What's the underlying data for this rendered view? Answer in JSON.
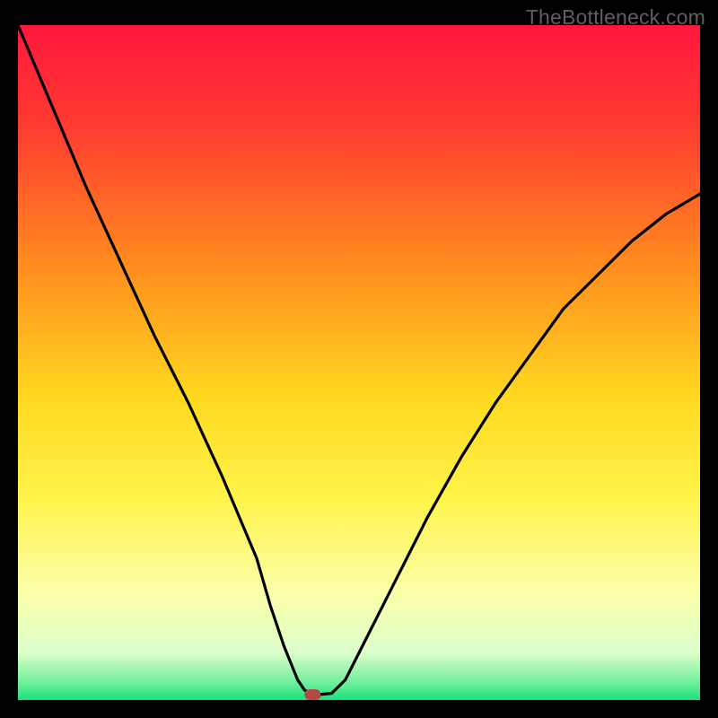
{
  "watermark": "TheBottleneck.com",
  "chart_data": {
    "type": "line",
    "title": "",
    "xlabel": "",
    "ylabel": "",
    "xlim": [
      0,
      100
    ],
    "ylim": [
      0,
      100
    ],
    "x": [
      0,
      5,
      10,
      15,
      20,
      25,
      30,
      35,
      37,
      39,
      41,
      42,
      43,
      44,
      46,
      48,
      50,
      55,
      60,
      65,
      70,
      75,
      80,
      85,
      90,
      95,
      100
    ],
    "values": [
      100,
      88,
      76,
      65,
      54,
      44,
      33,
      21,
      14,
      8,
      3,
      1.5,
      0.8,
      0.8,
      1,
      3,
      7,
      17,
      27,
      36,
      44,
      51,
      58,
      63,
      68,
      72,
      75
    ],
    "marker": {
      "x": 43.2,
      "y": 0.8,
      "color": "#b24a45",
      "w": 2.4,
      "h": 1.6
    },
    "gradient_stops": [
      {
        "offset": 0.0,
        "color": "#ff173e"
      },
      {
        "offset": 0.15,
        "color": "#ff3b30"
      },
      {
        "offset": 0.35,
        "color": "#ff8a1f"
      },
      {
        "offset": 0.55,
        "color": "#ffd81f"
      },
      {
        "offset": 0.7,
        "color": "#fff44a"
      },
      {
        "offset": 0.84,
        "color": "#fbffa8"
      },
      {
        "offset": 0.93,
        "color": "#dbffcb"
      },
      {
        "offset": 0.975,
        "color": "#6eef9a"
      },
      {
        "offset": 1.0,
        "color": "#18e07e"
      }
    ]
  }
}
